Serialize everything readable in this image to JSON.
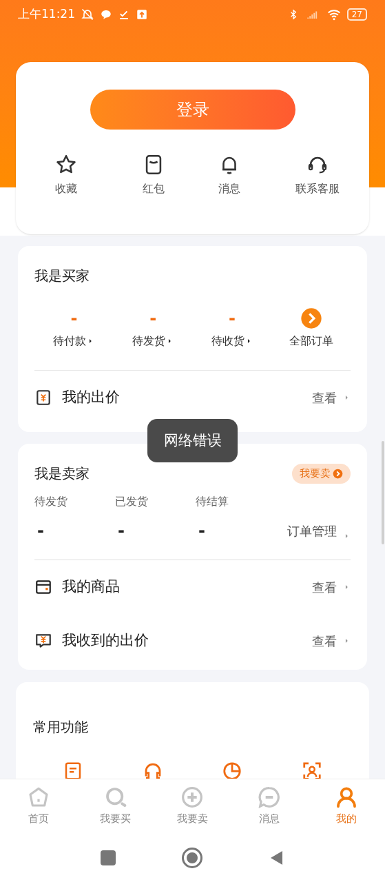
{
  "status_bar": {
    "time": "上午11:21",
    "battery": "27"
  },
  "account": {
    "login_button": "登录",
    "shortcuts": [
      {
        "kind": "star",
        "label": "收藏"
      },
      {
        "kind": "envelope",
        "label": "红包"
      },
      {
        "kind": "bell",
        "label": "消息"
      },
      {
        "kind": "headset",
        "label": "联系客服"
      }
    ]
  },
  "buyer": {
    "title": "我是买家",
    "orders": [
      {
        "kind": "count",
        "value": "-",
        "label": "待付款"
      },
      {
        "kind": "count",
        "value": "-",
        "label": "待发货"
      },
      {
        "kind": "count",
        "value": "-",
        "label": "待收货"
      },
      {
        "kind": "all",
        "label": "全部订单"
      }
    ],
    "rows": [
      {
        "kind": "bid",
        "label": "我的出价",
        "action": "查看"
      }
    ]
  },
  "seller": {
    "title": "我是卖家",
    "sell_button": "我要卖",
    "stats": [
      {
        "label": "待发货",
        "value": "-"
      },
      {
        "label": "已发货",
        "value": "-"
      },
      {
        "label": "待结算",
        "value": "-"
      }
    ],
    "manage_link": "订单管理",
    "rows": [
      {
        "kind": "goods",
        "label": "我的商品",
        "action": "查看"
      },
      {
        "kind": "offer",
        "label": "我收到的出价",
        "action": "查看"
      }
    ]
  },
  "common": {
    "title": "常用功能",
    "icons": [
      {
        "kind": "note"
      },
      {
        "kind": "headphones"
      },
      {
        "kind": "pie"
      },
      {
        "kind": "scan"
      }
    ]
  },
  "toast": "网络错误",
  "tabs": [
    {
      "kind": "home",
      "label": "首页",
      "selected": false
    },
    {
      "kind": "search",
      "label": "我要买",
      "selected": false
    },
    {
      "kind": "plus",
      "label": "我要卖",
      "selected": false
    },
    {
      "kind": "chat",
      "label": "消息",
      "selected": false
    },
    {
      "kind": "user",
      "label": "我的",
      "selected": true
    }
  ]
}
